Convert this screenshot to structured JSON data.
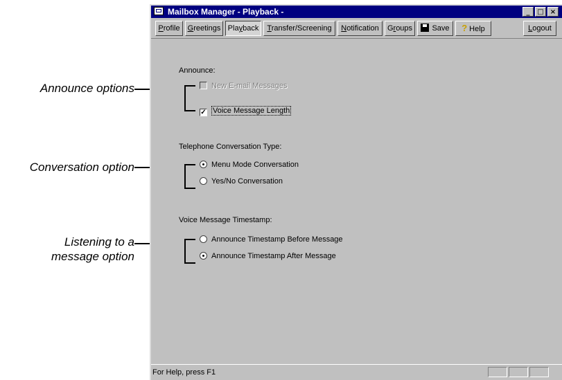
{
  "window": {
    "title": "Mailbox Manager - Playback -",
    "controls": {
      "minimize": "_",
      "maximize": "□",
      "close": "×"
    }
  },
  "toolbar": {
    "tabs": [
      {
        "label_pre": "",
        "label_u": "P",
        "label_post": "rofile"
      },
      {
        "label_pre": "",
        "label_u": "G",
        "label_post": "reetings"
      },
      {
        "label_pre": "Pla",
        "label_u": "y",
        "label_post": "back"
      },
      {
        "label_pre": "",
        "label_u": "T",
        "label_post": "ransfer/Screening"
      },
      {
        "label_pre": "",
        "label_u": "N",
        "label_post": "otification"
      },
      {
        "label_pre": "G",
        "label_u": "r",
        "label_post": "oups"
      }
    ],
    "save_label": "Save",
    "help_label": "Help",
    "logout_pre": "",
    "logout_u": "L",
    "logout_post": "ogout",
    "active_tab": "Playback"
  },
  "announce": {
    "label": "Announce:",
    "new_email": {
      "label": "New E-mail Messages",
      "checked": false,
      "enabled": false
    },
    "voice_length": {
      "label": "Voice Message Length",
      "checked": true,
      "check_mark": "✓"
    }
  },
  "conversation": {
    "label": "Telephone Conversation Type:",
    "menu_mode": {
      "label": "Menu Mode Conversation",
      "selected": true
    },
    "yes_no": {
      "label": "Yes/No Conversation",
      "selected": false
    }
  },
  "timestamp": {
    "label": "Voice Message Timestamp:",
    "before": {
      "label": "Announce Timestamp Before Message",
      "selected": false
    },
    "after": {
      "label": "Announce Timestamp After Message",
      "selected": true
    }
  },
  "status": {
    "text": "For Help, press F1"
  },
  "callouts": {
    "announce": "Announce options",
    "conversation": "Conversation option",
    "listening_line1": "Listening to a",
    "listening_line2": "message option"
  },
  "colors": {
    "titlebar": "#000080",
    "window_face": "#c0c0c0",
    "disabled_text": "#808080"
  }
}
